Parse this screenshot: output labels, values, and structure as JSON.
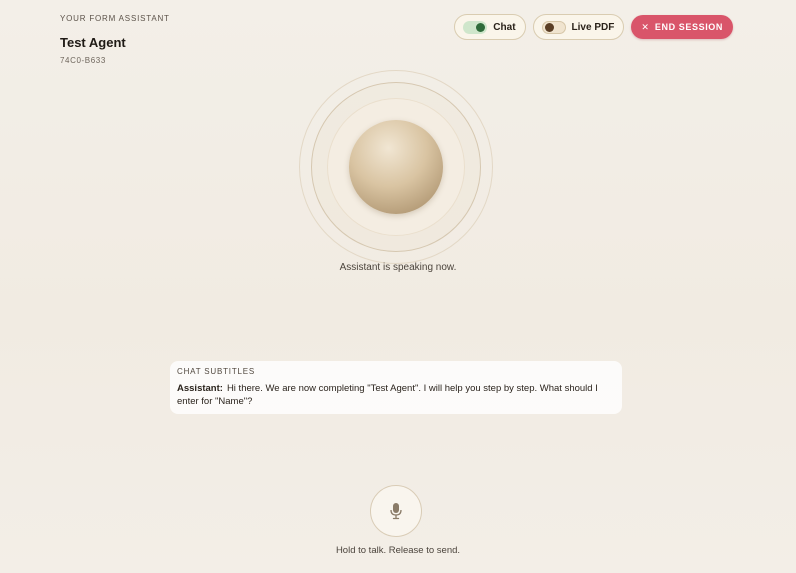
{
  "header": {
    "eyebrow": "YOUR FORM ASSISTANT",
    "agent_name": "Test Agent",
    "agent_id": "74C0-B633"
  },
  "controls": {
    "chat": {
      "label": "Chat",
      "enabled": true
    },
    "live_pdf": {
      "label": "Live PDF",
      "enabled": false
    },
    "end_session": {
      "icon": "close-icon",
      "label": "END SESSION",
      "color": "#d9556a"
    }
  },
  "orb": {
    "status": "Assistant is speaking now."
  },
  "subtitles": {
    "heading": "CHAT SUBTITLES",
    "speaker": "Assistant:",
    "message": "Hi there. We are now completing \"Test Agent\". I will help you step by step. What should I enter for \"Name\"?"
  },
  "mic": {
    "icon": "microphone-icon",
    "hint": "Hold to talk. Release to send."
  }
}
